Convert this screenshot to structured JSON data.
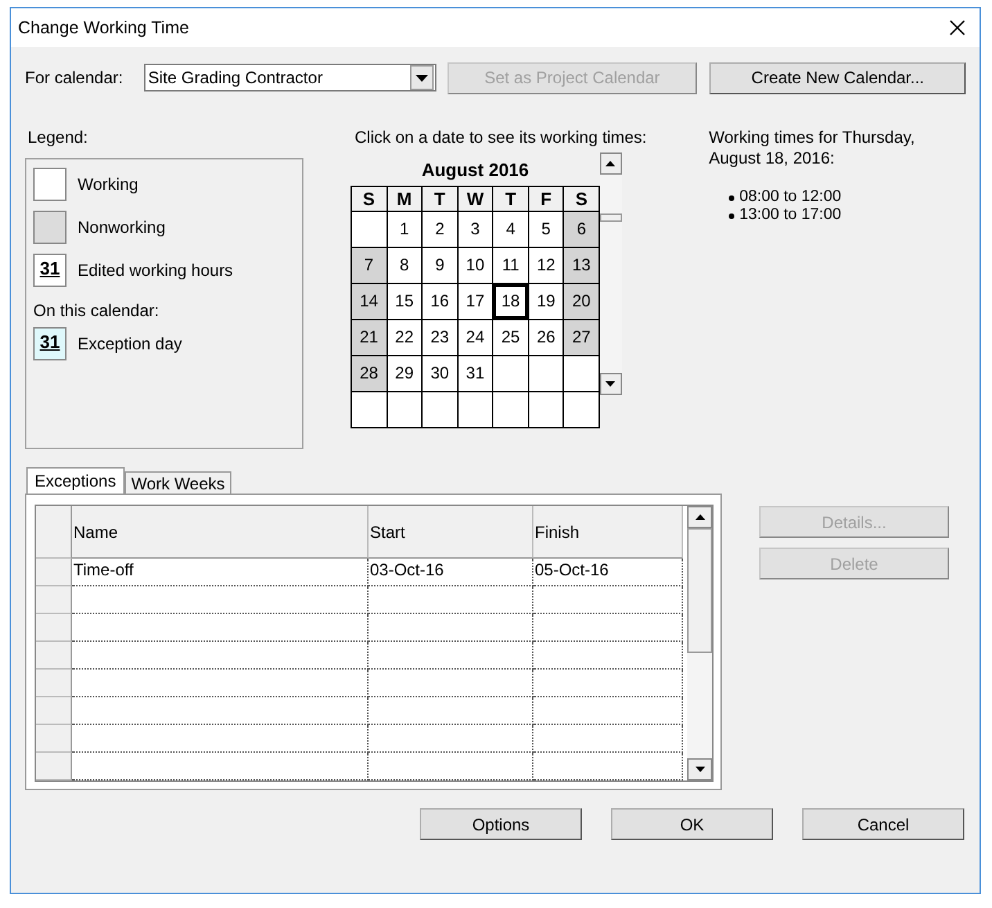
{
  "window": {
    "title": "Change Working Time"
  },
  "for_calendar": {
    "label": "For calendar:",
    "value": "Site Grading Contractor"
  },
  "top_buttons": [
    {
      "label": "Set as Project Calendar",
      "disabled": true
    },
    {
      "label": "Create New Calendar...",
      "disabled": false
    }
  ],
  "legend": {
    "title": "Legend:",
    "items": [
      {
        "kind": "working",
        "label": "Working"
      },
      {
        "kind": "nonworking",
        "label": "Nonworking"
      },
      {
        "kind": "edited",
        "icon_text": "31",
        "label": "Edited working hours"
      },
      {
        "kind": "heading",
        "label": "On this calendar:"
      },
      {
        "kind": "exception",
        "icon_text": "31",
        "label": "Exception day"
      }
    ]
  },
  "calendar": {
    "prompt": "Click on a date to see its working times:",
    "month": "August 2016",
    "weekdays": [
      "S",
      "M",
      "T",
      "W",
      "T",
      "F",
      "S"
    ],
    "weeks": [
      [
        {
          "day": "1",
          "nonworking": false,
          "selected": false
        },
        {
          "day": "2",
          "nonworking": false,
          "selected": false
        },
        {
          "day": "3",
          "nonworking": false,
          "selected": false
        },
        {
          "day": "4",
          "nonworking": false,
          "selected": false
        },
        {
          "day": "5",
          "nonworking": false,
          "selected": false
        },
        {
          "day": "6",
          "nonworking": true,
          "selected": false
        }
      ],
      [
        {
          "day": "7",
          "nonworking": true,
          "selected": false
        },
        {
          "day": "8",
          "nonworking": false,
          "selected": false
        },
        {
          "day": "9",
          "nonworking": false,
          "selected": false
        },
        {
          "day": "10",
          "nonworking": false,
          "selected": false
        },
        {
          "day": "11",
          "nonworking": false,
          "selected": false
        },
        {
          "day": "12",
          "nonworking": false,
          "selected": false
        },
        {
          "day": "13",
          "nonworking": true,
          "selected": false
        }
      ],
      [
        {
          "day": "14",
          "nonworking": true,
          "selected": false
        },
        {
          "day": "15",
          "nonworking": false,
          "selected": false
        },
        {
          "day": "16",
          "nonworking": false,
          "selected": false
        },
        {
          "day": "17",
          "nonworking": false,
          "selected": false
        },
        {
          "day": "18",
          "nonworking": false,
          "selected": true
        },
        {
          "day": "19",
          "nonworking": false,
          "selected": false
        },
        {
          "day": "20",
          "nonworking": true,
          "selected": false
        }
      ],
      [
        {
          "day": "21",
          "nonworking": true,
          "selected": false
        },
        {
          "day": "22",
          "nonworking": false,
          "selected": false
        },
        {
          "day": "23",
          "nonworking": false,
          "selected": false
        },
        {
          "day": "24",
          "nonworking": false,
          "selected": false
        },
        {
          "day": "25",
          "nonworking": false,
          "selected": false
        },
        {
          "day": "26",
          "nonworking": false,
          "selected": false
        },
        {
          "day": "27",
          "nonworking": true,
          "selected": false
        }
      ],
      [
        {
          "day": "28",
          "nonworking": true,
          "selected": false
        },
        {
          "day": "29",
          "nonworking": false,
          "selected": false
        },
        {
          "day": "30",
          "nonworking": false,
          "selected": false
        },
        {
          "day": "31",
          "nonworking": false,
          "selected": false
        }
      ]
    ]
  },
  "working_times": {
    "heading": "Working times for Thursday, August 18, 2016:",
    "times": [
      "08:00 to 12:00",
      "13:00 to 17:00"
    ]
  },
  "tabs": [
    {
      "label": "Exceptions",
      "selected": true
    },
    {
      "label": "Work Weeks",
      "selected": false
    }
  ],
  "table": {
    "columns": [
      "Name",
      "Start",
      "Finish"
    ],
    "rows": [
      [
        "Time-off",
        "03-Oct-16",
        "05-Oct-16"
      ]
    ]
  },
  "side_buttons": [
    {
      "label": "Details...",
      "disabled": true
    },
    {
      "label": "Delete",
      "disabled": true
    }
  ],
  "bottom_buttons": [
    "Options",
    "OK",
    "Cancel"
  ]
}
